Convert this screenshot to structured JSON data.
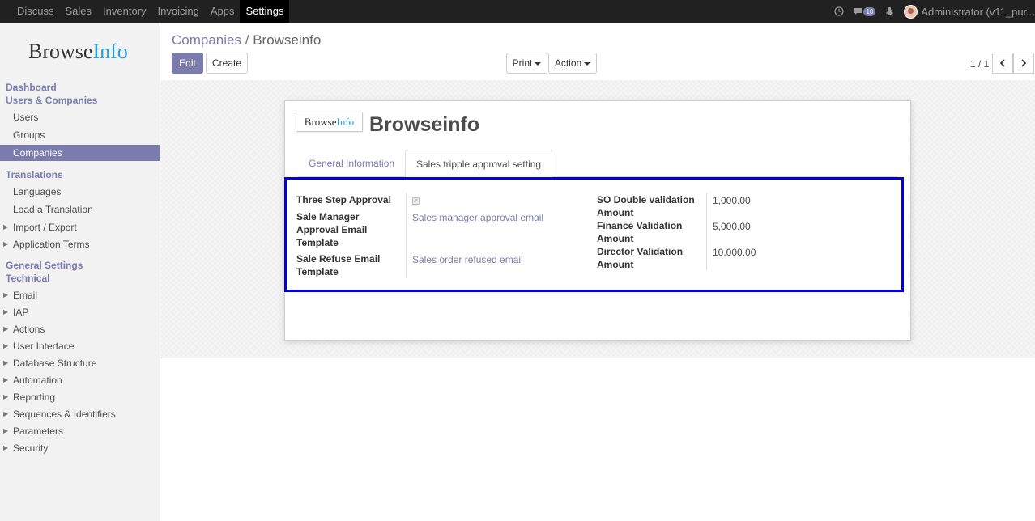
{
  "topbar": {
    "menus": [
      "Discuss",
      "Sales",
      "Inventory",
      "Invoicing",
      "Apps",
      "Settings"
    ],
    "active_menu": "Settings",
    "message_count": "10",
    "user": "Administrator (v11_pur..."
  },
  "sidebar": {
    "logo": {
      "part1": "Browse",
      "part2": "Info"
    },
    "dashboard": "Dashboard",
    "users_companies": "Users & Companies",
    "users": "Users",
    "groups": "Groups",
    "companies": "Companies",
    "translations": "Translations",
    "languages": "Languages",
    "load_translation": "Load a Translation",
    "import_export": "Import / Export",
    "application_terms": "Application Terms",
    "general_settings": "General Settings",
    "technical": "Technical",
    "email": "Email",
    "iap": "IAP",
    "actions": "Actions",
    "user_interface": "User Interface",
    "database_structure": "Database Structure",
    "automation": "Automation",
    "reporting": "Reporting",
    "sequences": "Sequences & Identifiers",
    "parameters": "Parameters",
    "security": "Security"
  },
  "control_panel": {
    "breadcrumb_parent": "Companies",
    "breadcrumb_sep": "/",
    "breadcrumb_current": "Browseinfo",
    "edit": "Edit",
    "create": "Create",
    "print": "Print",
    "action": "Action",
    "pager": "1 / 1"
  },
  "form": {
    "logo": {
      "part1": "Browse",
      "part2": "Info"
    },
    "company_name": "Browseinfo",
    "tabs": [
      "General Information",
      "Sales tripple approval setting"
    ],
    "active_tab": "Sales tripple approval setting",
    "left_fields": {
      "three_step_label": "Three Step Approval",
      "three_step_checked": true,
      "sale_manager_label_1": "Sale Manager",
      "sale_manager_label_2": "Approval Email",
      "sale_manager_label_3": "Template",
      "sale_manager_value": "Sales manager approval email",
      "refuse_label_1": "Sale Refuse Email",
      "refuse_label_2": "Template",
      "refuse_value": "Sales order refused email"
    },
    "right_fields": {
      "so_double_label_1": "SO Double validation",
      "so_double_label_2": "Amount",
      "so_double_value": "1,000.00",
      "finance_label_1": "Finance Validation",
      "finance_label_2": "Amount",
      "finance_value": "5,000.00",
      "director_label_1": "Director Validation",
      "director_label_2": "Amount",
      "director_value": "10,000.00"
    }
  },
  "colors": {
    "brand": "#7c7bad",
    "highlight_box": "#0000e0",
    "navbar": "#212121"
  }
}
